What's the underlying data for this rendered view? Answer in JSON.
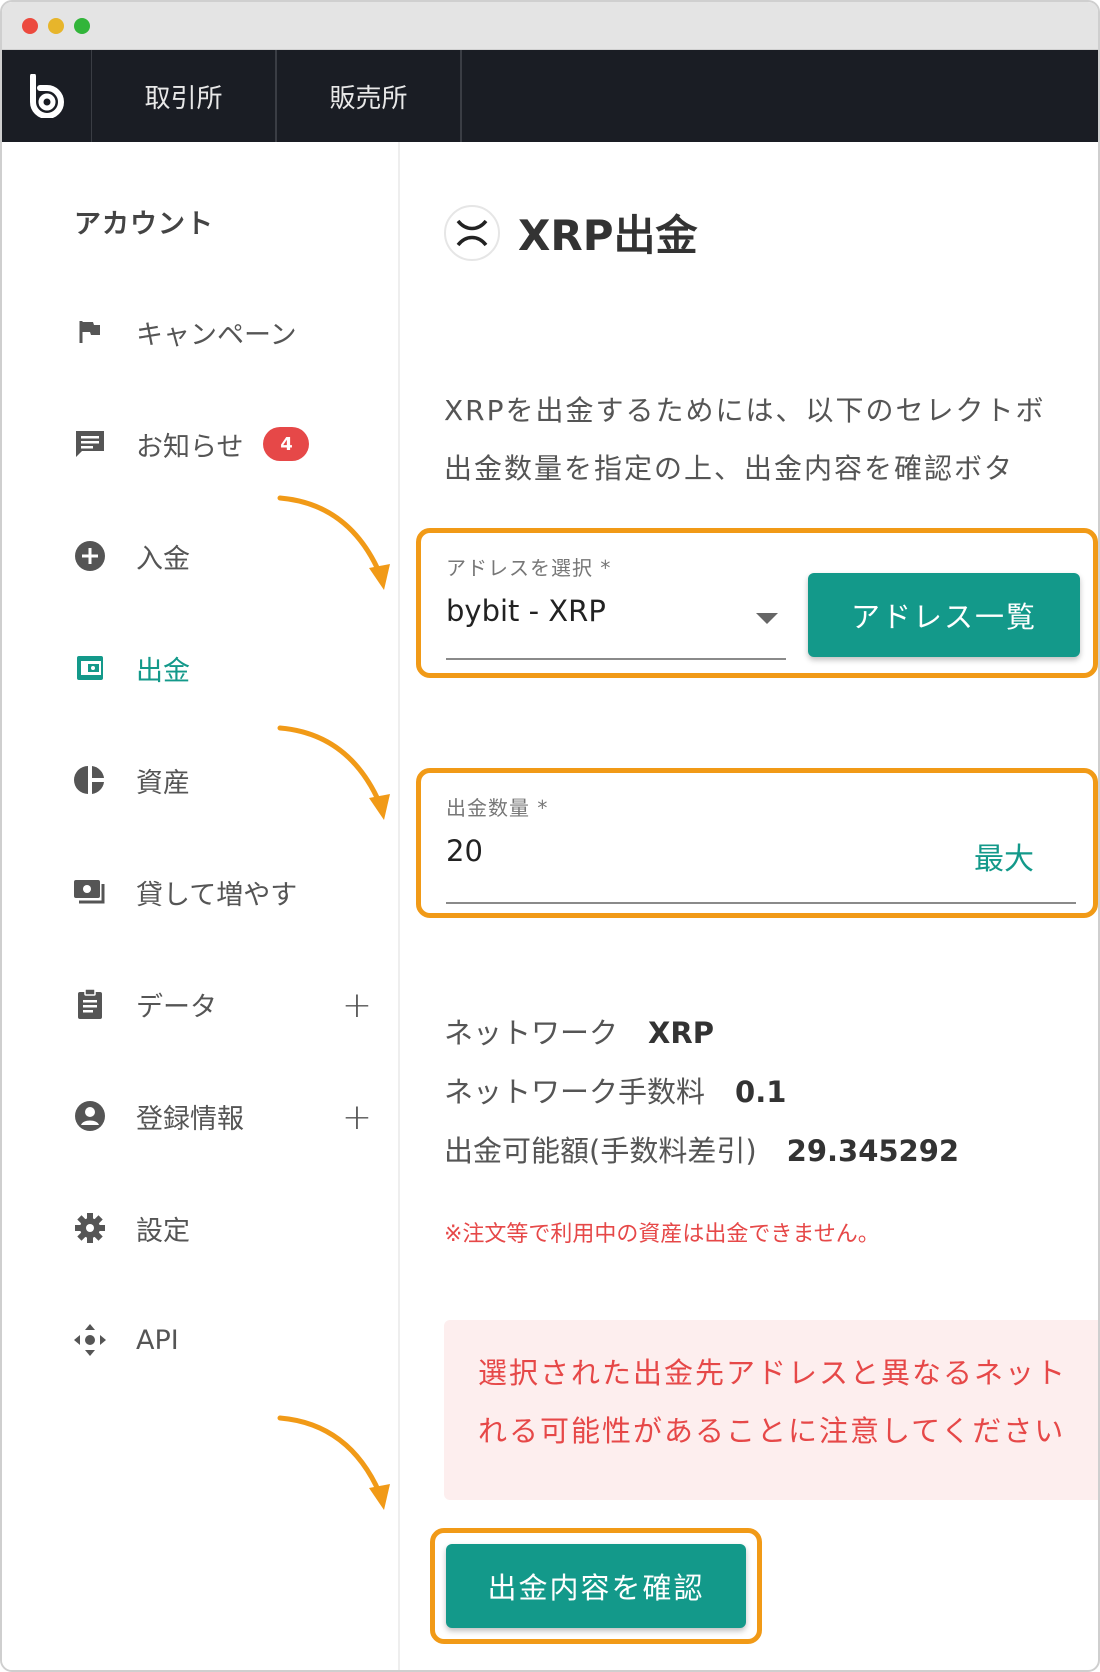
{
  "nav": {
    "items": [
      {
        "label": "取引所"
      },
      {
        "label": "販売所"
      }
    ]
  },
  "sidebar": {
    "title": "アカウント",
    "items": [
      {
        "label": "キャンペーン",
        "icon": "flag-icon"
      },
      {
        "label": "お知らせ",
        "icon": "message-icon",
        "badge": "4"
      },
      {
        "label": "入金",
        "icon": "plus-circle-icon"
      },
      {
        "label": "出金",
        "icon": "wallet-icon",
        "active": true
      },
      {
        "label": "資産",
        "icon": "pie-chart-icon"
      },
      {
        "label": "貸して増やす",
        "icon": "lend-icon"
      },
      {
        "label": "データ",
        "icon": "clipboard-icon",
        "expand": "+"
      },
      {
        "label": "登録情報",
        "icon": "account-icon",
        "expand": "+"
      },
      {
        "label": "設定",
        "icon": "gear-icon"
      },
      {
        "label": "API",
        "icon": "api-icon"
      }
    ]
  },
  "main": {
    "title": "XRP出金",
    "description": [
      "XRPを出金するためには、以下のセレクトボ",
      "出金数量を指定の上、出金内容を確認ボタ"
    ],
    "address_field": {
      "label": "アドレスを選択 *",
      "value": "bybit - XRP",
      "button": "アドレス一覧"
    },
    "amount_field": {
      "label": "出金数量 *",
      "value": "20",
      "max_label": "最大"
    },
    "info": [
      {
        "label": "ネットワーク",
        "value": "XRP"
      },
      {
        "label": "ネットワーク手数料",
        "value": "0.1"
      },
      {
        "label": "出金可能額(手数料差引)",
        "value": "29.345292"
      }
    ],
    "note": "※注文等で利用中の資産は出金できません。",
    "alert": [
      "選択された出金先アドレスと異なるネット",
      "れる可能性があることに注意してください"
    ],
    "confirm_button": "出金内容を確認"
  },
  "colors": {
    "accent": "#13998a",
    "highlight": "#f19a17",
    "danger": "#e64848",
    "nav_bg": "#1a1d24"
  }
}
